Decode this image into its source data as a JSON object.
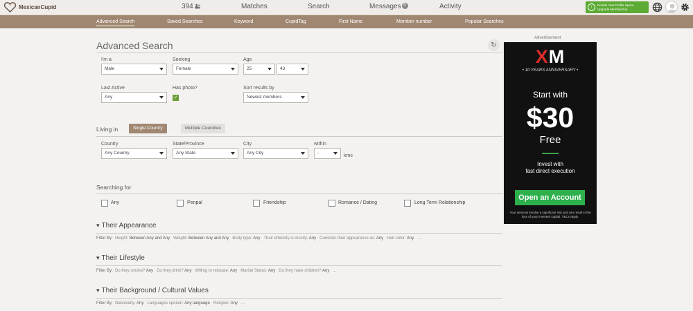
{
  "header": {
    "logo_text": "MexicanCupid",
    "nav": {
      "count": "394",
      "matches": "Matches",
      "search": "Search",
      "messages": "Messages",
      "messages_badge": "0",
      "activity": "Activity"
    },
    "upgrade": {
      "line1": "Double Your Profile Space",
      "line2": "Upgrade Membership"
    }
  },
  "subnav": {
    "advanced_search": "Advanced Search",
    "saved_searches": "Saved Searches",
    "keyword": "Keyword",
    "cupidtag": "CupidTag",
    "first_name": "First Name",
    "member_number": "Member number",
    "popular_searches": "Popular Searches"
  },
  "page": {
    "title": "Advanced Search",
    "reset_icon": "refresh-icon"
  },
  "form": {
    "im_a_label": "I'm a",
    "im_a_value": "Male",
    "seeking_label": "Seeking",
    "seeking_value": "Female",
    "age_label": "Age",
    "age_min": "25",
    "age_max": "43",
    "last_active_label": "Last Active",
    "last_active_value": "Any",
    "has_photo_label": "Has photo?",
    "sort_label": "Sort results by",
    "sort_value": "Newest members",
    "living_in_label": "Living in",
    "single_country": "Single Country",
    "multiple_countries": "Multiple Countries",
    "country_label": "Country",
    "country_value": "Any Country",
    "state_label": "State/Province",
    "state_value": "Any State",
    "city_label": "City",
    "city_value": "Any City",
    "within_label": "within",
    "within_value": "-",
    "kms": "kms",
    "searching_for_label": "Searching for",
    "searching_options": [
      "Any",
      "Penpal",
      "Friendship",
      "Romance / Dating",
      "Long Term Relationship"
    ]
  },
  "sections": {
    "appearance": {
      "title": "Their Appearance",
      "filter_by": "Filter By:",
      "items": [
        "Height:",
        "Between Any and Any",
        "Weight:",
        "Between Any and Any",
        "Body type:",
        "Any",
        "Their ethnicity is mostly:",
        "Any",
        "Consider their appearance as:",
        "Any",
        "Hair color:",
        "Any",
        "..."
      ]
    },
    "lifestyle": {
      "title": "Their Lifestyle",
      "filter_by": "Filter By:",
      "items": [
        "Do they smoke?",
        "Any",
        "Do they drink?",
        "Any",
        "Willing to relocate:",
        "Any",
        "Marital Status:",
        "Any",
        "Do they have children?",
        "Any",
        "..."
      ]
    },
    "background": {
      "title": "Their Background / Cultural Values",
      "filter_by": "Filter By:",
      "items": [
        "Nationality:",
        "Any",
        "Languages spoken:",
        "Any language",
        "Religion:",
        "Any",
        "..."
      ]
    }
  },
  "ad": {
    "label": "Advertisement",
    "brand_x": "X",
    "brand_m": "M",
    "anniversary": "• 10 YEARS ANNIVERSARY •",
    "start_with": "Start with",
    "amount": "$30",
    "free": "Free",
    "invest_line1": "Invest with",
    "invest_line2": "fast direct execution",
    "cta": "Open an Account",
    "disclaimer": "Your services involve a significant risk and can result in the loss of your invested capital. T&Cs Apply."
  },
  "colors": {
    "brand_brown": "#a08771",
    "upgrade_green": "#5cab34",
    "ad_green": "#2db04b",
    "ad_red": "#d92b2b"
  }
}
